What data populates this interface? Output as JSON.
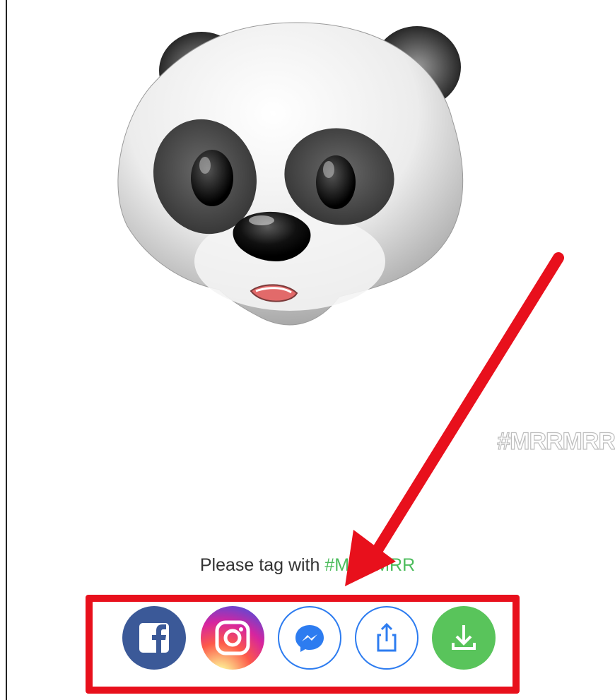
{
  "watermark": "#MRRMRR",
  "footer": {
    "tag_prefix": "Please tag with ",
    "hashtag": "#MRRMRR"
  },
  "share_buttons": [
    {
      "name": "facebook",
      "icon": "facebook-icon"
    },
    {
      "name": "instagram",
      "icon": "instagram-icon"
    },
    {
      "name": "messenger",
      "icon": "messenger-icon"
    },
    {
      "name": "share",
      "icon": "share-icon"
    },
    {
      "name": "download",
      "icon": "download-icon"
    }
  ],
  "colors": {
    "highlight": "#e8101c",
    "hashtag": "#4cbc5c",
    "facebook": "#3b5998",
    "messenger": "#2d7cf0",
    "download": "#59c45b"
  }
}
